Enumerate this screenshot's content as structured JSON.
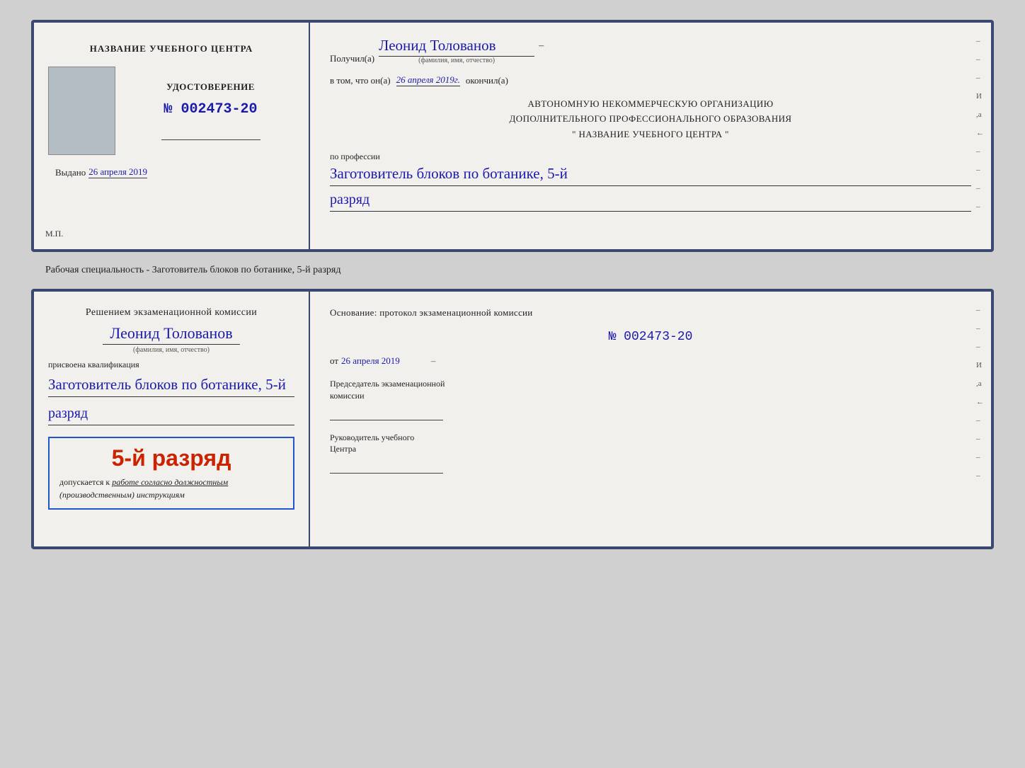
{
  "cert1": {
    "left": {
      "title": "НАЗВАНИЕ УЧЕБНОГО ЦЕНТРА",
      "cert_label": "УДОСТОВЕРЕНИЕ",
      "cert_number": "№ 002473-20",
      "issued_label": "Выдано",
      "issued_date": "26 апреля 2019",
      "mp_label": "М.П."
    },
    "right": {
      "received_label": "Получил(а)",
      "recipient_name": "Леонид Толованов",
      "recipient_sub": "(фамилия, имя, отчество)",
      "dash": "–",
      "in_that_label": "в том, что он(а)",
      "completed_date": "26 апреля 2019г.",
      "completed_label": "окончил(а)",
      "org_line1": "АВТОНОМНУЮ НЕКОММЕРЧЕСКУЮ ОРГАНИЗАЦИЮ",
      "org_line2": "ДОПОЛНИТЕЛЬНОГО ПРОФЕССИОНАЛЬНОГО ОБРАЗОВАНИЯ",
      "org_line3": "\"  НАЗВАНИЕ УЧЕБНОГО ЦЕНТРА  \"",
      "profession_label": "по профессии",
      "profession_value": "Заготовитель блоков по ботанике, 5-й",
      "rank_value": "разряд"
    }
  },
  "between_label": "Рабочая специальность - Заготовитель блоков по ботанике, 5-й разряд",
  "cert2": {
    "left": {
      "decision_text": "Решением экзаменационной комиссии",
      "name": "Леонид Толованов",
      "name_sub": "(фамилия, имя, отчество)",
      "qualification_label": "присвоена квалификация",
      "qualification_value": "Заготовитель блоков по ботанике, 5-й",
      "rank_value": "разряд",
      "rank_box_main": "5-й разряд",
      "admitted_label": "допускается к",
      "admitted_text": "работе согласно должностным",
      "admitted_text2": "(производственным) инструкциям"
    },
    "right": {
      "basis_label": "Основание: протокол экзаменационной комиссии",
      "basis_number": "№  002473-20",
      "basis_date_prefix": "от",
      "basis_date": "26 апреля 2019",
      "chairman_label": "Председатель экзаменационной",
      "chairman_label2": "комиссии",
      "head_label": "Руководитель учебного",
      "head_label2": "Центра",
      "side_marks": [
        "–",
        "–",
        "–",
        "И",
        ",а",
        "←",
        "–",
        "–",
        "–",
        "–"
      ]
    }
  }
}
